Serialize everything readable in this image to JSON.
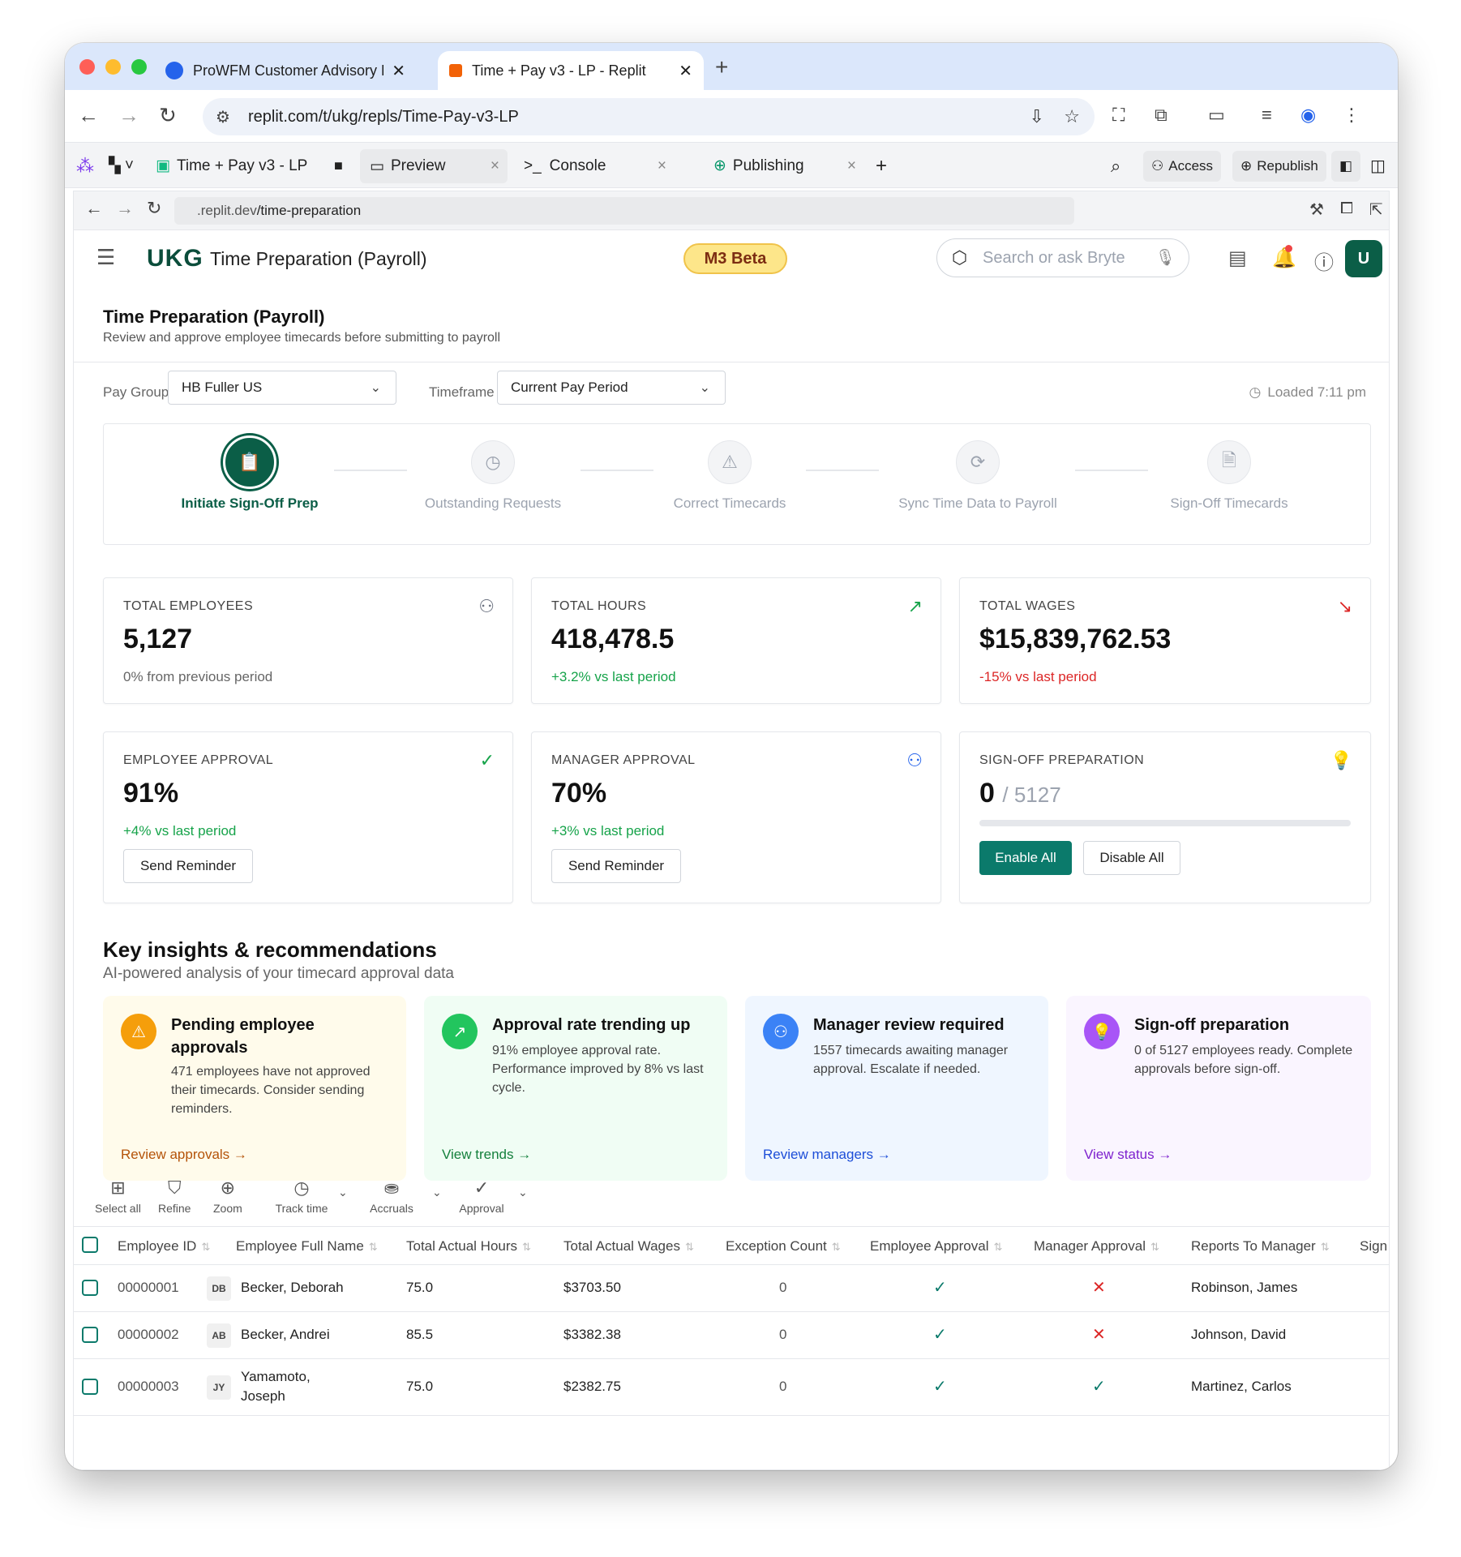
{
  "browser": {
    "tabs": [
      {
        "label": "ProWFM Customer Advisory E"
      },
      {
        "label": "Time + Pay v3 - LP - Replit"
      }
    ],
    "url": "replit.com/t/ukg/repls/Time-Pay-v3-LP"
  },
  "replit": {
    "project": "Time + Pay v3 - LP",
    "tabs": [
      "Preview",
      "Console",
      "Publishing"
    ],
    "access": "Access",
    "republish": "Republish",
    "preview_url_prefix": ".replit.dev",
    "preview_url_path": "/time-preparation"
  },
  "app": {
    "logo": "UKG",
    "title": "Time Preparation (Payroll)",
    "badge": "M3 Beta",
    "search_placeholder": "Search or ask Bryte",
    "avatar": "U",
    "page_title": "Time Preparation (Payroll)",
    "page_subtitle": "Review and approve employee timecards before submitting to payroll",
    "filters": {
      "pay_group_label": "Pay Group",
      "pay_group_value": "HB Fuller US",
      "timeframe_label": "Timeframe",
      "timeframe_value": "Current Pay Period",
      "loaded": "Loaded 7:11 pm"
    },
    "steps": [
      "Initiate Sign-Off Prep",
      "Outstanding Requests",
      "Correct Timecards",
      "Sync Time Data to Payroll",
      "Sign-Off Timecards"
    ],
    "metrics": [
      {
        "label": "TOTAL EMPLOYEES",
        "value": "5,127",
        "sub": "0% from previous period"
      },
      {
        "label": "TOTAL HOURS",
        "value": "418,478.5",
        "sub": "+3.2% vs last period"
      },
      {
        "label": "TOTAL WAGES",
        "value": "$15,839,762.53",
        "sub": "-15% vs last period"
      },
      {
        "label": "EMPLOYEE APPROVAL",
        "value": "91%",
        "sub": "+4% vs last period",
        "button": "Send Reminder"
      },
      {
        "label": "MANAGER APPROVAL",
        "value": "70%",
        "sub": "+3% vs last period",
        "button": "Send Reminder"
      },
      {
        "label": "SIGN-OFF PREPARATION",
        "value": "0",
        "total": "/ 5127",
        "progress": 0,
        "enable": "Enable All",
        "disable": "Disable All"
      }
    ],
    "insights_title": "Key insights & recommendations",
    "insights_subtitle": "AI-powered analysis of your timecard approval data",
    "insights": [
      {
        "title": "Pending employee approvals",
        "desc": "471 employees have not approved their timecards. Consider sending reminders.",
        "action": "Review approvals →"
      },
      {
        "title": "Approval rate trending up",
        "desc": "91% employee approval rate. Performance improved by 8% vs last cycle.",
        "action": "View trends →"
      },
      {
        "title": "Manager review required",
        "desc": "1557 timecards awaiting manager approval. Escalate if needed.",
        "action": "Review managers →"
      },
      {
        "title": "Sign-off preparation",
        "desc": "0 of 5127 employees ready. Complete approvals before sign-off.",
        "action": "View status →"
      }
    ],
    "toolbar": [
      "Select all",
      "Refine",
      "Zoom",
      "Track time",
      "Accruals",
      "Approval"
    ],
    "columns": [
      "Employee ID",
      "Employee Full Name",
      "Total Actual Hours",
      "Total Actual Wages",
      "Exception Count",
      "Employee Approval",
      "Manager Approval",
      "Reports To Manager",
      "Sign"
    ],
    "rows": [
      {
        "id": "00000001",
        "initials": "DB",
        "name": "Becker, Deborah",
        "hours": "75.0",
        "wages": "$3703.50",
        "exceptions": "0",
        "emp_ok": true,
        "mgr_ok": false,
        "manager": "Robinson, James"
      },
      {
        "id": "00000002",
        "initials": "AB",
        "name": "Becker, Andrei",
        "hours": "85.5",
        "wages": "$3382.38",
        "exceptions": "0",
        "emp_ok": true,
        "mgr_ok": false,
        "manager": "Johnson, David"
      },
      {
        "id": "00000003",
        "initials": "JY",
        "name": "Yamamoto, Joseph",
        "name_line1": "Yamamoto,",
        "name_line2": "Joseph",
        "hours": "75.0",
        "wages": "$2382.75",
        "exceptions": "0",
        "emp_ok": true,
        "mgr_ok": true,
        "manager": "Martinez, Carlos"
      }
    ]
  }
}
